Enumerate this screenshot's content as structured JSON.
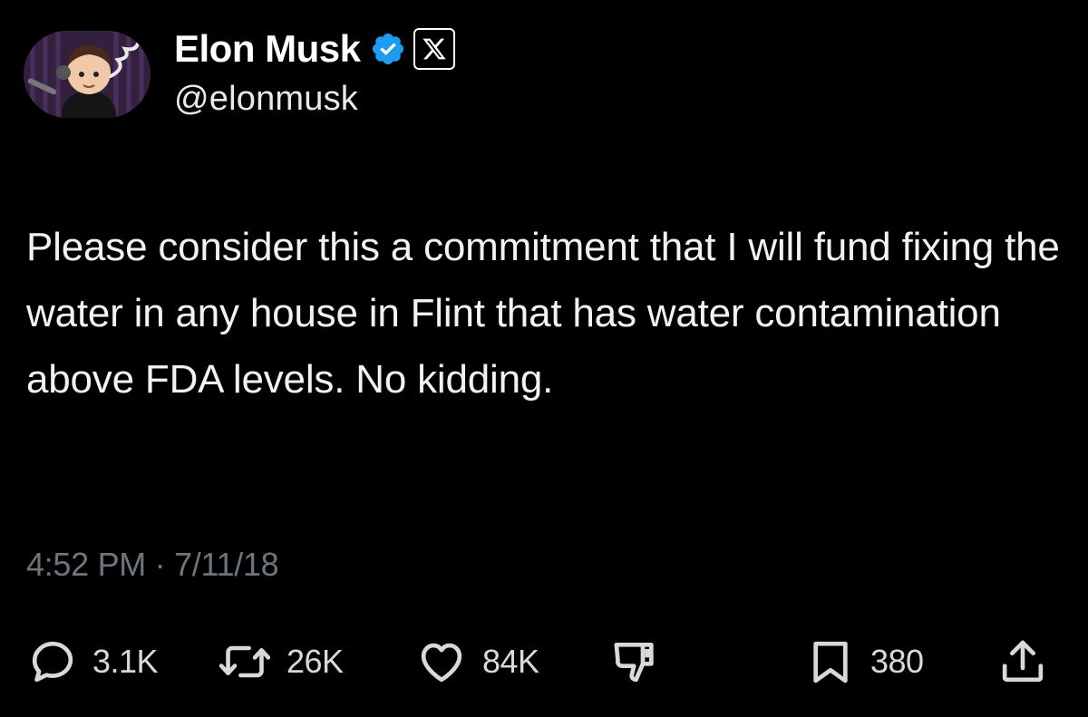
{
  "author": {
    "display_name": "Elon Musk",
    "handle": "@elonmusk",
    "verified": true,
    "affiliation_badge": "x-logo-icon"
  },
  "tweet": {
    "text": "Please consider this a commitment that I will fund fixing the water in any house in Flint that has water contamination above FDA levels. No kidding.",
    "timestamp": "4:52 PM · 7/11/18"
  },
  "actions": {
    "replies": "3.1K",
    "reposts": "26K",
    "likes": "84K",
    "bookmarks": "380"
  },
  "icons": {
    "reply": "reply-icon",
    "repost": "repost-icon",
    "like": "like-icon",
    "dislike": "dislike-icon",
    "bookmark": "bookmark-icon",
    "share": "share-icon"
  },
  "colors": {
    "background": "#000000",
    "verified_blue": "#1d9bf0",
    "text": "#e7e9ea",
    "muted": "#6e767d"
  }
}
